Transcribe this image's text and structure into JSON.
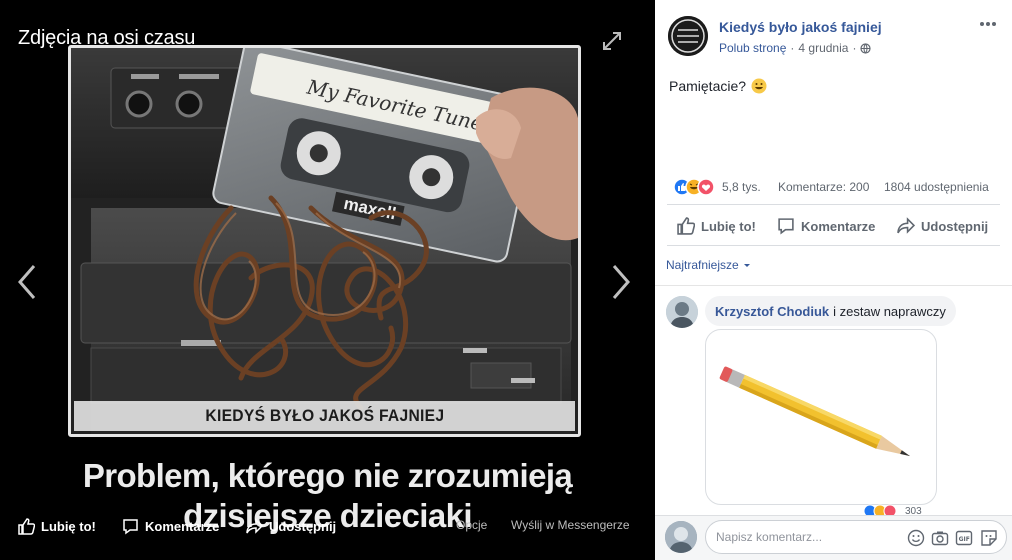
{
  "viewer": {
    "title": "Zdjęcia na osi czasu",
    "photo_caption": "KIEDYŚ BYŁO JAKOŚ FAJNIEJ",
    "photo_note_text": "My Favorite Tunes!",
    "photo_brand": "maxell",
    "overlay_line1": "Problem, którego nie zrozumieją",
    "overlay_line2": "dzisiejsze dzieciaki",
    "actions": {
      "like": "Lubię to!",
      "comment": "Komentarze",
      "share": "Udostępnij",
      "options": "Opcje",
      "messenger": "Wyślij w Messengerze"
    }
  },
  "post": {
    "page_name": "Kiedyś było jakoś fajniej",
    "follow_link": "Polub stronę",
    "separator": "·",
    "date": "4 grudnia",
    "text": "Pamiętacie?",
    "reactions_count": "5,8 tys.",
    "comments_count": "Komentarze: 200",
    "shares_count": "1804 udostępnienia",
    "actions": {
      "like": "Lubię to!",
      "comment": "Komentarze",
      "share": "Udostępnij"
    },
    "sort_label": "Najtrafniejsze"
  },
  "comment": {
    "author": "Krzysztof Chodiuk",
    "text": "i zestaw naprawczy",
    "reaction_count": "303"
  },
  "compose": {
    "placeholder": "Napisz komentarz..."
  },
  "colors": {
    "link": "#365899",
    "like_blue": "#2078f4",
    "love_red": "#f25268",
    "haha_yellow": "#f7b125"
  }
}
